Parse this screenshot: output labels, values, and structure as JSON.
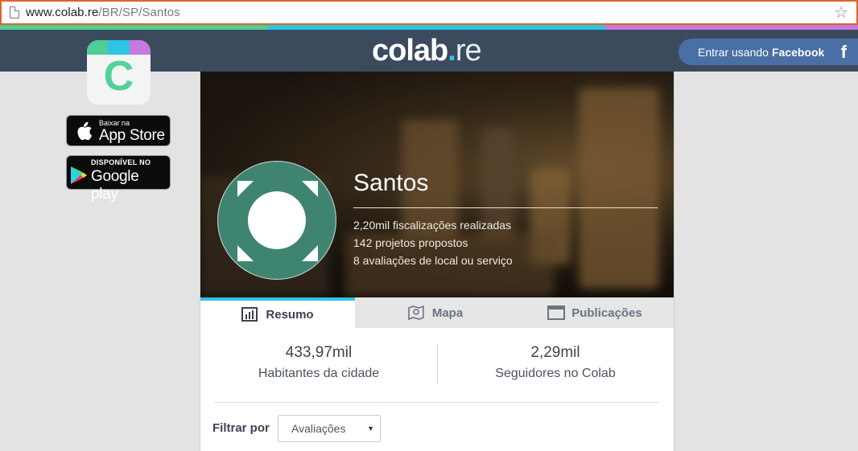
{
  "browser": {
    "url_host": "www.colab.re",
    "url_path": "/BR/SP/Santos"
  },
  "header": {
    "logo_main": "colab",
    "logo_dot": ".",
    "logo_suffix": "re",
    "facebook_login_prefix": "Entrar usando",
    "facebook_login_brand": "Facebook",
    "facebook_icon": "f"
  },
  "sidebar": {
    "app_icon_letter": "C",
    "app_store_small": "Baixar na",
    "app_store_big": "App Store",
    "google_play_small": "DISPONÍVEL NO",
    "google_play_big": "Google play"
  },
  "city": {
    "name": "Santos",
    "stats": [
      "2,20mil fiscalizações realizadas",
      "142 projetos propostos",
      "8 avaliações de local ou serviço"
    ]
  },
  "tabs": [
    {
      "label": "Resumo",
      "icon": "bar-chart-icon",
      "active": true
    },
    {
      "label": "Mapa",
      "icon": "map-pin-icon",
      "active": false
    },
    {
      "label": "Publicações",
      "icon": "browser-window-icon",
      "active": false
    }
  ],
  "summary": {
    "population_value": "433,97mil",
    "population_label": "Habitantes da cidade",
    "followers_value": "2,29mil",
    "followers_label": "Seguidores no Colab"
  },
  "filter": {
    "label": "Filtrar por",
    "selected": "Avaliações"
  },
  "colors": {
    "header_bg": "#3c4a5e",
    "accent_cyan": "#2ec4e6",
    "brand_green": "#4fce97",
    "avatar_green": "#3f8470",
    "facebook_blue": "#4a6fa5"
  }
}
